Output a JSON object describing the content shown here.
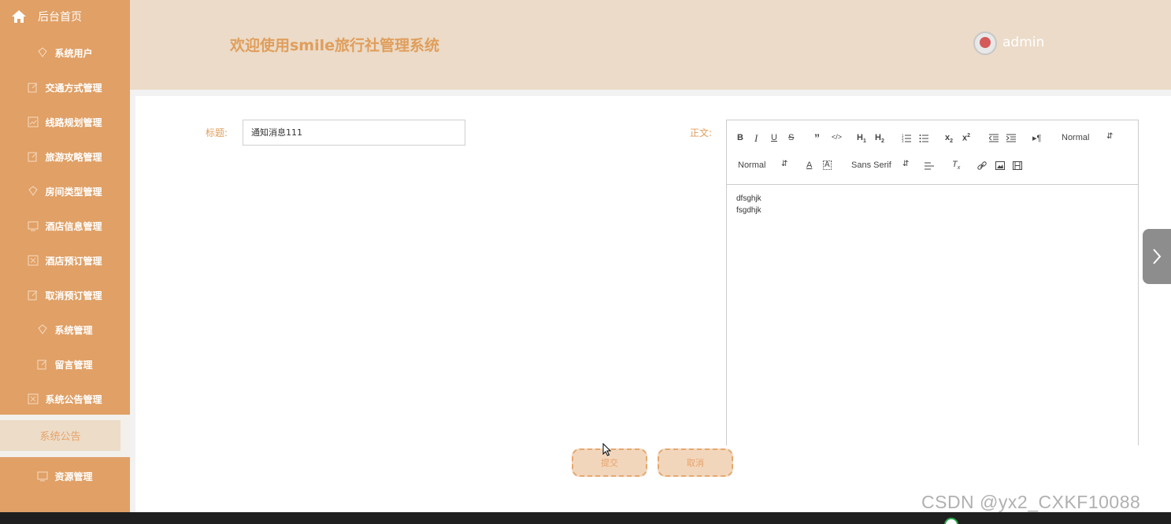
{
  "sidebar": {
    "home_label": "后台首页",
    "items": [
      {
        "label": "系统用户",
        "icon": "diamond-icon"
      },
      {
        "label": "交通方式管理",
        "icon": "edit-icon"
      },
      {
        "label": "线路规划管理",
        "icon": "chart-icon"
      },
      {
        "label": "旅游攻略管理",
        "icon": "edit-icon"
      },
      {
        "label": "房间类型管理",
        "icon": "diamond-icon"
      },
      {
        "label": "酒店信息管理",
        "icon": "monitor-icon"
      },
      {
        "label": "酒店预订管理",
        "icon": "box-icon"
      },
      {
        "label": "取消预订管理",
        "icon": "edit-icon"
      },
      {
        "label": "系统管理",
        "icon": "diamond-icon"
      },
      {
        "label": "留言管理",
        "icon": "edit-icon"
      },
      {
        "label": "系统公告管理",
        "icon": "box-icon"
      }
    ],
    "active_sub": "系统公告",
    "last_item": {
      "label": "资源管理",
      "icon": "monitor-icon"
    }
  },
  "header": {
    "title": "欢迎使用smile旅行社管理系统",
    "username": "admin"
  },
  "form": {
    "title_label": "标题:",
    "title_value": "通知消息111",
    "body_label": "正文:",
    "editor": {
      "header_select": "Normal",
      "size_select": "Normal",
      "font_select": "Sans Serif",
      "lines": [
        "dfsghjk",
        "fsgdhjk"
      ]
    },
    "submit_label": "提交",
    "cancel_label": "取消"
  },
  "watermark": "CSDN @yx2_CXKF10088",
  "colors": {
    "sidebar": "#e0a066",
    "header": "#ebdbc8",
    "accent": "#e09e5c"
  }
}
